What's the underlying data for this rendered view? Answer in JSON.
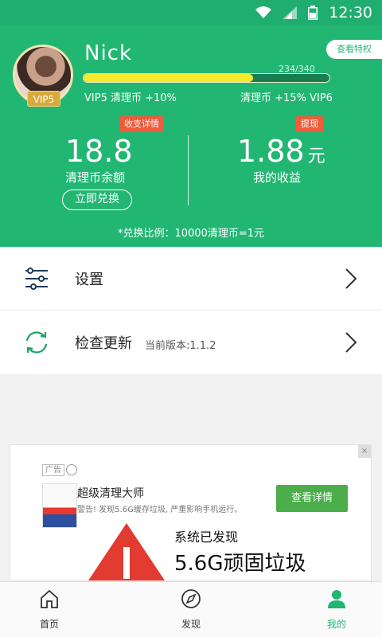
{
  "status_bar": {
    "time": "12:30"
  },
  "profile": {
    "name": "Nick",
    "vip_badge": "VIP5",
    "privilege_button": "查看特权",
    "progress_text": "234/340",
    "progress_fraction": 0.69,
    "current_level_text": "VIP5 清理币 +10%",
    "next_level_text": "清理币 +15%   VIP6"
  },
  "balance": {
    "tag": "收支详情",
    "value": "18.8",
    "label": "清理币余额",
    "redeem_button": "立即兑换"
  },
  "earnings": {
    "tag": "提现",
    "value": "1.88",
    "unit": "元",
    "label": "我的收益"
  },
  "exchange_rate": "*兑换比例：10000清理币=1元",
  "menu": {
    "settings": "设置",
    "update": "检查更新",
    "version": "当前版本:1.1.2"
  },
  "ad": {
    "tag": "广告",
    "app_name": "超级清理大师",
    "app_desc": "警告! 发现5.6G缓存垃圾, 严重影响手机运行。",
    "cta": "查看详情",
    "headline": "系统已发现",
    "big_text": "5.6G顽固垃圾"
  },
  "bottom_nav": {
    "home": "首页",
    "discover": "发现",
    "mine": "我的"
  },
  "colors": {
    "primary_green": "#22b673",
    "progress_yellow": "#f5ea2c",
    "tag_red": "#ef5b3b",
    "ad_button_green": "#4cae4a"
  }
}
